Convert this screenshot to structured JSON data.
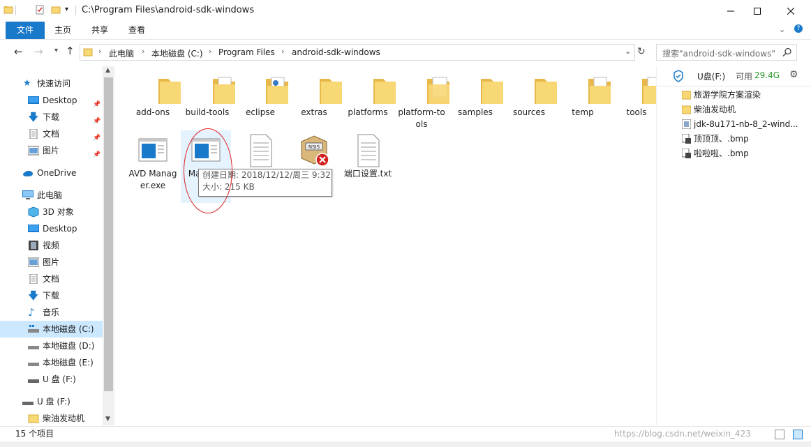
{
  "window": {
    "title": "C:\\Program Files\\android-sdk-windows",
    "controls": {
      "minimize": "—",
      "maximize": "☐",
      "close": "✕"
    }
  },
  "ribbon": {
    "tabs": [
      "文件",
      "主页",
      "共享",
      "查看"
    ]
  },
  "address": {
    "crumbs": [
      "此电脑",
      "本地磁盘 (C:)",
      "Program Files",
      "android-sdk-windows"
    ],
    "search_placeholder": "搜索\"android-sdk-windows\""
  },
  "nav": {
    "items": [
      {
        "label": "快速访问",
        "icon": "star-icon"
      },
      {
        "label": "Desktop",
        "icon": "desktop-icon",
        "pinned": true
      },
      {
        "label": "下载",
        "icon": "download-icon",
        "pinned": true
      },
      {
        "label": "文档",
        "icon": "document-icon",
        "pinned": true
      },
      {
        "label": "图片",
        "icon": "picture-icon",
        "pinned": true
      },
      {
        "label": "OneDrive",
        "icon": "cloud-icon"
      },
      {
        "label": "此电脑",
        "icon": "computer-icon"
      },
      {
        "label": "3D 对象",
        "icon": "cube-icon"
      },
      {
        "label": "Desktop",
        "icon": "desktop-icon"
      },
      {
        "label": "视频",
        "icon": "video-icon"
      },
      {
        "label": "图片",
        "icon": "picture-icon"
      },
      {
        "label": "文档",
        "icon": "document-icon"
      },
      {
        "label": "下载",
        "icon": "download-icon"
      },
      {
        "label": "音乐",
        "icon": "music-icon"
      },
      {
        "label": "本地磁盘 (C:)",
        "icon": "drive-icon",
        "selected": true
      },
      {
        "label": "本地磁盘 (D:)",
        "icon": "drive-icon"
      },
      {
        "label": "本地磁盘 (E:)",
        "icon": "drive-icon"
      },
      {
        "label": "U 盘 (F:)",
        "icon": "usb-drive-icon"
      },
      {
        "label": "U 盘 (F:)",
        "icon": "usb-drive-icon"
      },
      {
        "label": "柴油发动机",
        "icon": "folder-icon"
      }
    ]
  },
  "files": [
    {
      "name": "add-ons",
      "type": "folder"
    },
    {
      "name": "build-tools",
      "type": "folder"
    },
    {
      "name": "eclipse",
      "type": "folder"
    },
    {
      "name": "extras",
      "type": "folder"
    },
    {
      "name": "platforms",
      "type": "folder"
    },
    {
      "name": "platform-tools",
      "type": "folder"
    },
    {
      "name": "samples",
      "type": "folder"
    },
    {
      "name": "sources",
      "type": "folder"
    },
    {
      "name": "temp",
      "type": "folder"
    },
    {
      "name": "tools",
      "type": "folder"
    },
    {
      "name": "AVD Manager.exe",
      "type": "exe"
    },
    {
      "name": "Ma...exe",
      "type": "exe"
    },
    {
      "name": "",
      "type": "text"
    },
    {
      "name": "",
      "type": "nsis"
    },
    {
      "name": "端口设置.txt",
      "type": "text"
    }
  ],
  "tooltip": {
    "created": "创建日期: 2018/12/12/周三 9:32",
    "size": "大小: 215 KB"
  },
  "preview": {
    "drive_label": "U盘(F:)",
    "free_label": "可用",
    "free_value": "29.4G",
    "items": [
      {
        "label": "旅游学院方案渲染",
        "icon": "folder-icon"
      },
      {
        "label": "柴油发动机",
        "icon": "folder-icon"
      },
      {
        "label": "jdk-8u171-nb-8_2-wind...",
        "icon": "java-icon"
      },
      {
        "label": "顶顶顶、.bmp",
        "icon": "bmp-icon"
      },
      {
        "label": "啦啦啦、.bmp",
        "icon": "bmp-icon"
      }
    ]
  },
  "status": {
    "count": "15 个项目",
    "watermark": "https://blog.csdn.net/weixin_423"
  },
  "colors": {
    "accent": "#1979ca",
    "selected": "#cce8ff",
    "folder": "#f8d775"
  }
}
